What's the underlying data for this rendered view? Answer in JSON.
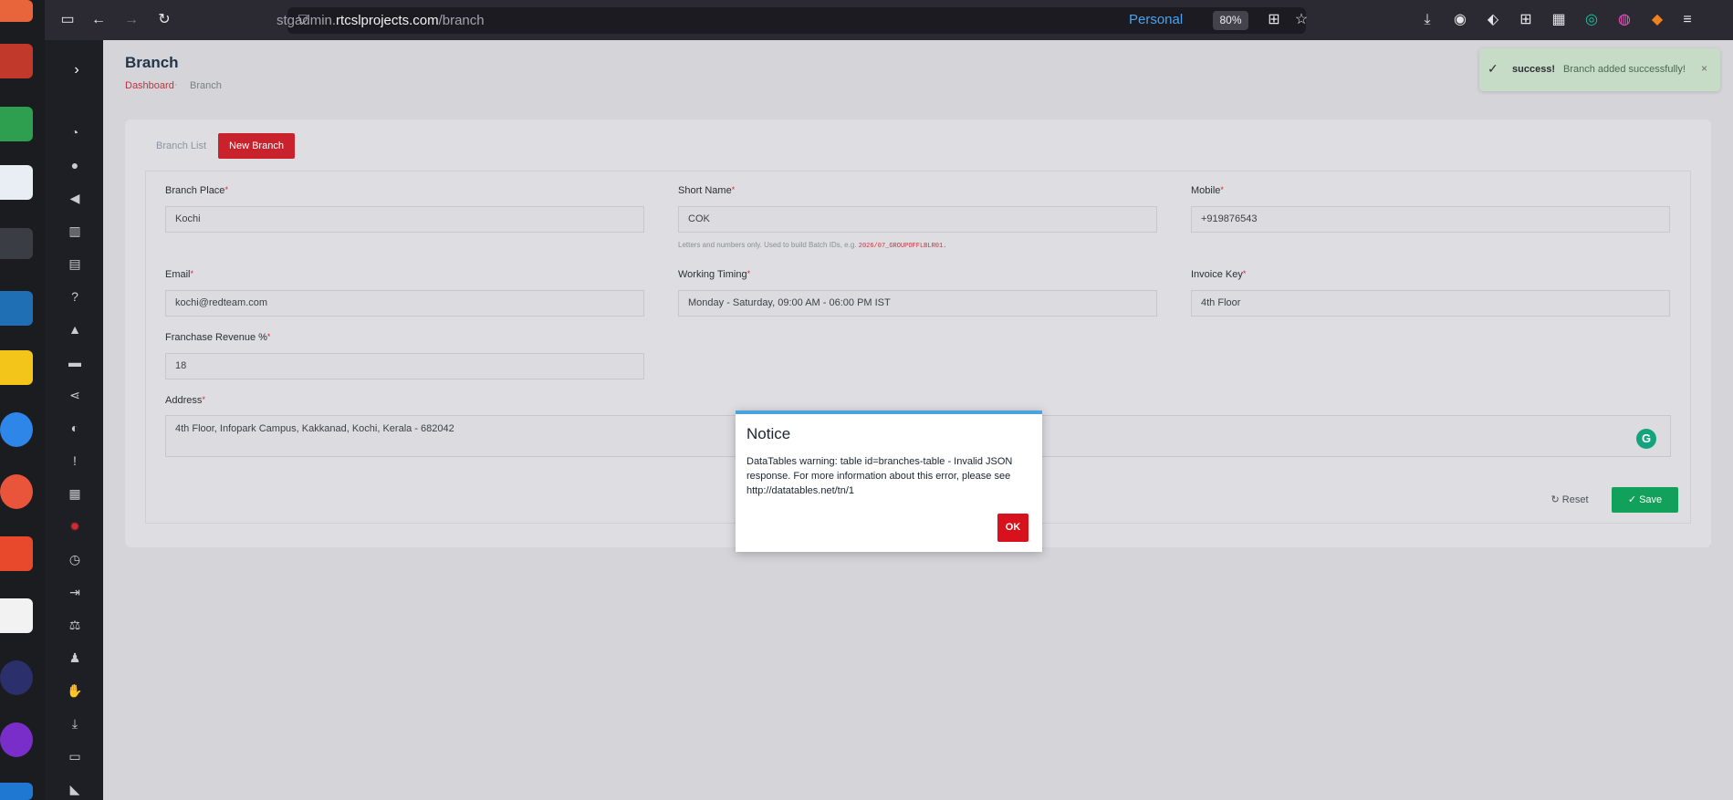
{
  "browser": {
    "url_prefix": "stgadmin.",
    "url_domain": "rtcslprojects.com",
    "url_path": "/branch",
    "container": "Personal",
    "zoom": "80%"
  },
  "page": {
    "title": "Branch",
    "breadcrumb": {
      "home": "Dashboard",
      "current": "Branch"
    },
    "tabs": {
      "list": "Branch List",
      "new": "New Branch"
    }
  },
  "form": {
    "branch_place": {
      "label": "Branch Place",
      "value": "Kochi"
    },
    "short_name": {
      "label": "Short Name",
      "value": "COK",
      "help": "Letters and numbers only. Used to build Batch IDs, e.g.",
      "help_example": "2026/07_GROUPOFFLBLR01."
    },
    "mobile": {
      "label": "Mobile",
      "value": "+919876543"
    },
    "email": {
      "label": "Email",
      "value": "kochi@redteam.com"
    },
    "working_timing": {
      "label": "Working Timing",
      "value": "Monday - Saturday, 09:00 AM - 06:00 PM IST"
    },
    "invoice_key": {
      "label": "Invoice Key",
      "value": "4th Floor"
    },
    "franchise_revenue": {
      "label": "Franchase Revenue %",
      "value": "18"
    },
    "address": {
      "label": "Address",
      "value": "4th Floor, Infopark Campus, Kakkanad, Kochi, Kerala - 682042"
    },
    "reset_label": "Reset",
    "save_label": "Save"
  },
  "toast": {
    "title": "success!",
    "message": "Branch added successfully!"
  },
  "modal": {
    "title": "Notice",
    "message": "DataTables warning: table id=branches-table - Invalid JSON response. For more information about this error, please see http://datatables.net/tn/1",
    "ok_label": "OK"
  },
  "colors": {
    "accent_red": "#c9222d",
    "save_green": "#12a15a",
    "modal_top": "#4aa3df",
    "toast_bg": "#c7dcc7"
  }
}
